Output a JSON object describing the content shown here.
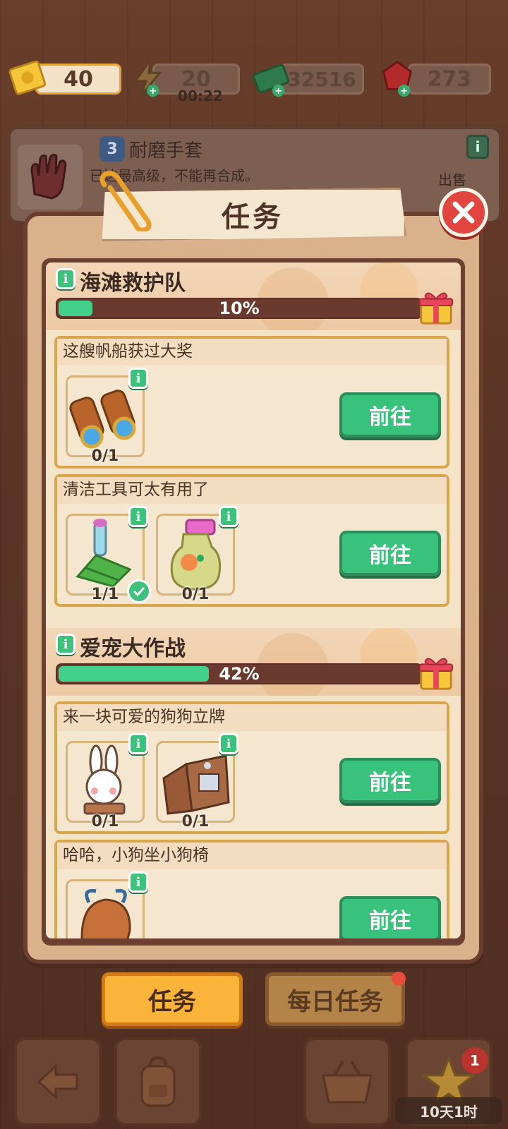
{
  "resources": {
    "tickets": "40",
    "energy": "20",
    "energy_timer": "00:22",
    "cash": "32516",
    "gems": "273"
  },
  "item_info": {
    "level": "3",
    "name": "耐磨手套",
    "description": "已达最高级，不能再合成。",
    "sell_label": "出售"
  },
  "modal": {
    "title": "任务"
  },
  "quests": [
    {
      "title": "海滩救护队",
      "progress_percent": 10,
      "progress_label": "10%",
      "tasks": [
        {
          "title": "这艘帆船获过大奖",
          "items": [
            {
              "icon": "binoculars-icon",
              "count": "0/1",
              "done": false
            }
          ],
          "button": "前往"
        },
        {
          "title": "清洁工具可太有用了",
          "items": [
            {
              "icon": "scrub-brush-icon",
              "count": "1/1",
              "done": true
            },
            {
              "icon": "spray-bottle-icon",
              "count": "0/1",
              "done": false
            }
          ],
          "button": "前往"
        }
      ]
    },
    {
      "title": "爱宠大作战",
      "progress_percent": 42,
      "progress_label": "42%",
      "tasks": [
        {
          "title": "来一块可爱的狗狗立牌",
          "items": [
            {
              "icon": "bunny-figure-icon",
              "count": "0/1",
              "done": false
            },
            {
              "icon": "cardboard-sign-icon",
              "count": "0/1",
              "done": false
            }
          ],
          "button": "前往"
        },
        {
          "title": "哈哈，小狗坐小狗椅",
          "items": [
            {
              "icon": "dog-chair-icon",
              "count": "",
              "done": false
            }
          ],
          "button": "前往"
        }
      ]
    }
  ],
  "tabs": {
    "tasks": "任务",
    "daily_tasks": "每日任务"
  },
  "toolbar": {
    "star_badge": "1",
    "event_timer": "10天1时"
  },
  "colors": {
    "accent_green": "#38c27c",
    "progress_fill": "#43d08a",
    "close_red": "#e2443f",
    "tab_active": "#fbb43a"
  }
}
